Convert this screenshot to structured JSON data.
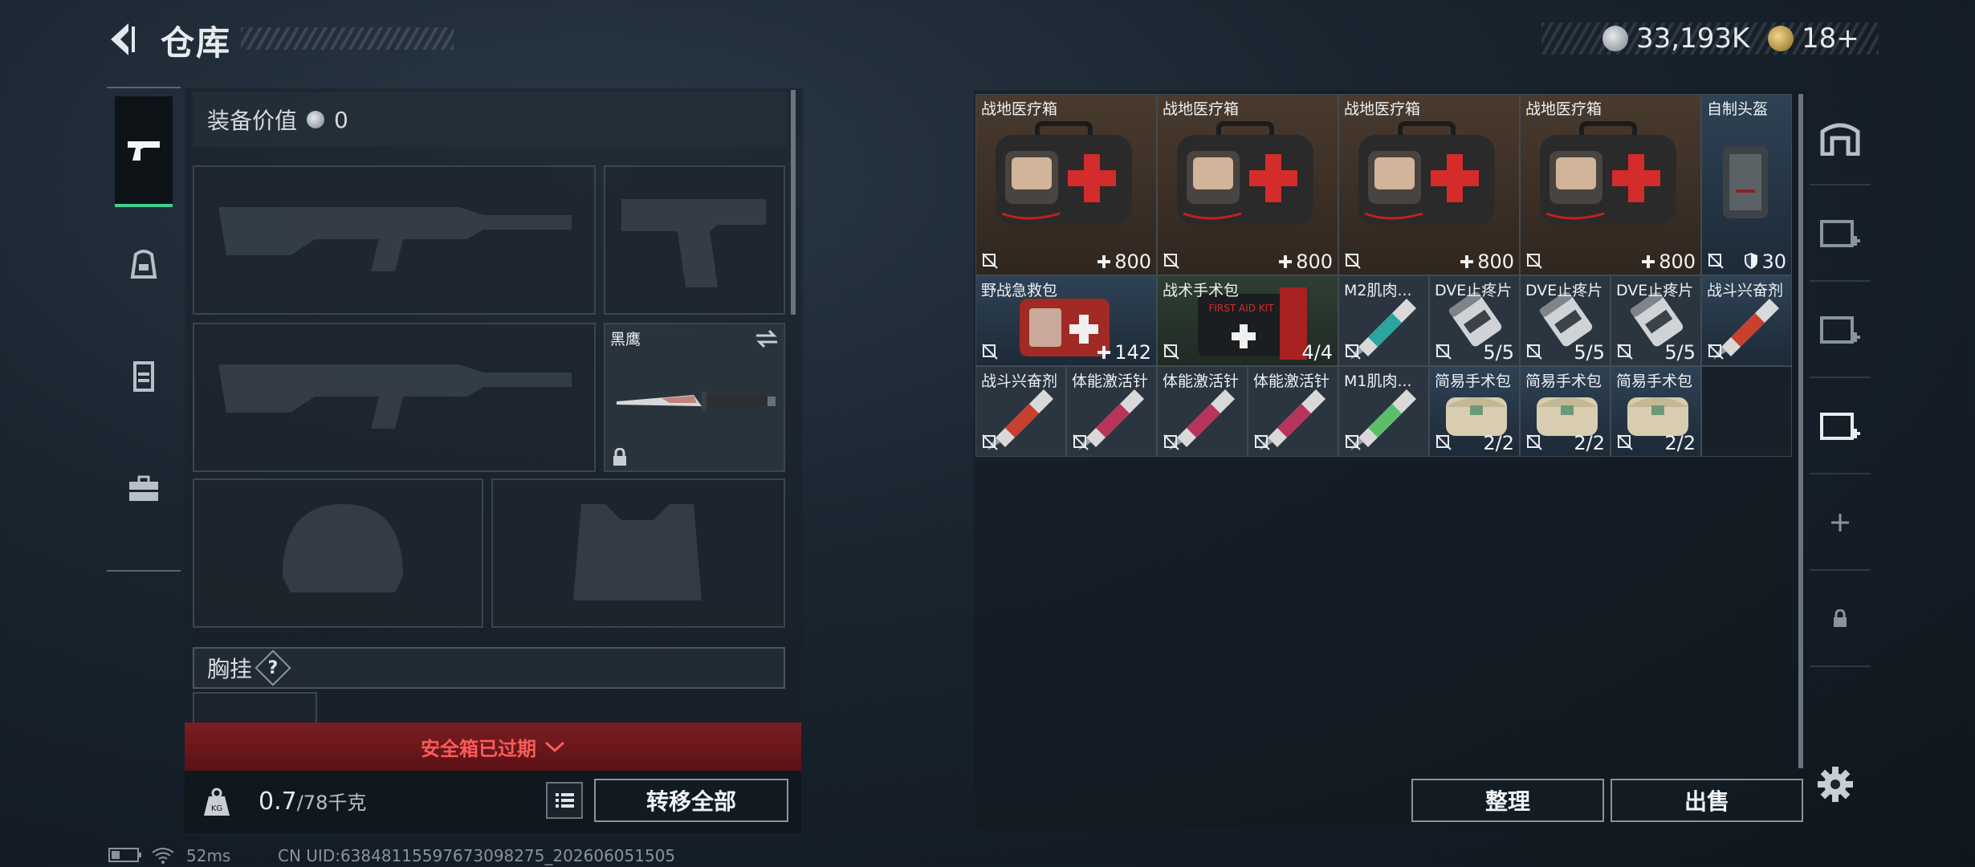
{
  "header": {
    "title": "仓库"
  },
  "currency": {
    "silver": "33,193K",
    "gold": "18+"
  },
  "equipment": {
    "value_label": "装备价值",
    "value": "0",
    "melee_name": "黑鹰",
    "chest_label": "胸挂",
    "chest_help": "?",
    "safebox_expired": "安全箱已过期"
  },
  "weight": {
    "current": "0.7",
    "max": "/78千克"
  },
  "buttons": {
    "transfer_all": "转移全部",
    "sort": "整理",
    "sell": "出售"
  },
  "inventory": {
    "items": [
      {
        "name": "战地医疗箱",
        "value": "800",
        "icon": "plus"
      },
      {
        "name": "战地医疗箱",
        "value": "800",
        "icon": "plus"
      },
      {
        "name": "战地医疗箱",
        "value": "800",
        "icon": "plus"
      },
      {
        "name": "战地医疗箱",
        "value": "800",
        "icon": "plus"
      },
      {
        "name": "自制头盔",
        "value": "30",
        "icon": "shield"
      },
      {
        "name": "野战急救包",
        "value": "142",
        "icon": "plus"
      },
      {
        "name": "战术手术包",
        "value": "4/4"
      },
      {
        "name": "M2肌肉...",
        "value": ""
      },
      {
        "name": "DVE止疼片",
        "value": "5/5"
      },
      {
        "name": "DVE止疼片",
        "value": "5/5"
      },
      {
        "name": "DVE止疼片",
        "value": "5/5"
      },
      {
        "name": "战斗兴奋剂",
        "value": ""
      },
      {
        "name": "战斗兴奋剂",
        "value": ""
      },
      {
        "name": "体能激活针",
        "value": ""
      },
      {
        "name": "体能激活针",
        "value": ""
      },
      {
        "name": "体能激活针",
        "value": ""
      },
      {
        "name": "M1肌肉...",
        "value": ""
      },
      {
        "name": "简易手术包",
        "value": "2/2"
      },
      {
        "name": "简易手术包",
        "value": "2/2"
      },
      {
        "name": "简易手术包",
        "value": "2/2"
      }
    ]
  },
  "footer": {
    "ping": "52ms",
    "uid": "CN UID:63848115597673098275_202606051505"
  }
}
